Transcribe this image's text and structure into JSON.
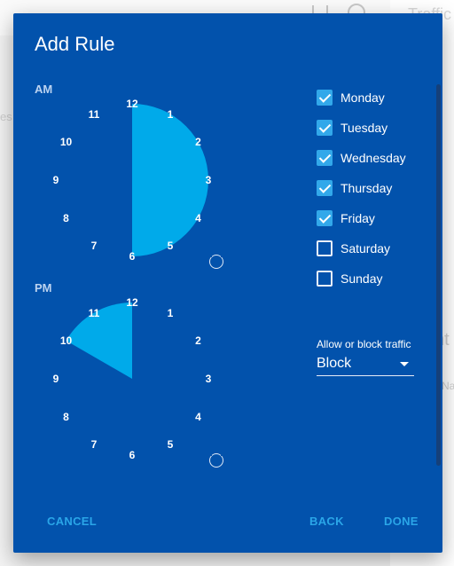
{
  "background": {
    "texts": [
      "Traffic",
      "es",
      "nt",
      "Nar"
    ]
  },
  "dialog": {
    "title": "Add Rule",
    "am_label": "AM",
    "pm_label": "PM",
    "clock_numbers": [
      "12",
      "1",
      "2",
      "3",
      "4",
      "5",
      "6",
      "7",
      "8",
      "9",
      "10",
      "11"
    ],
    "am_selection": {
      "from": "12",
      "to": "6"
    },
    "pm_selection": {
      "from": "10",
      "to": "12"
    },
    "colors": {
      "background": "#0252ac",
      "accent": "#00aaea",
      "button": "#2aa6e8"
    },
    "days": [
      {
        "label": "Monday",
        "checked": true
      },
      {
        "label": "Tuesday",
        "checked": true
      },
      {
        "label": "Wednesday",
        "checked": true
      },
      {
        "label": "Thursday",
        "checked": true
      },
      {
        "label": "Friday",
        "checked": true
      },
      {
        "label": "Saturday",
        "checked": false
      },
      {
        "label": "Sunday",
        "checked": false
      }
    ],
    "traffic_label": "Allow or block traffic",
    "traffic_value": "Block",
    "cancel_label": "CANCEL",
    "back_label": "BACK",
    "done_label": "DONE"
  }
}
